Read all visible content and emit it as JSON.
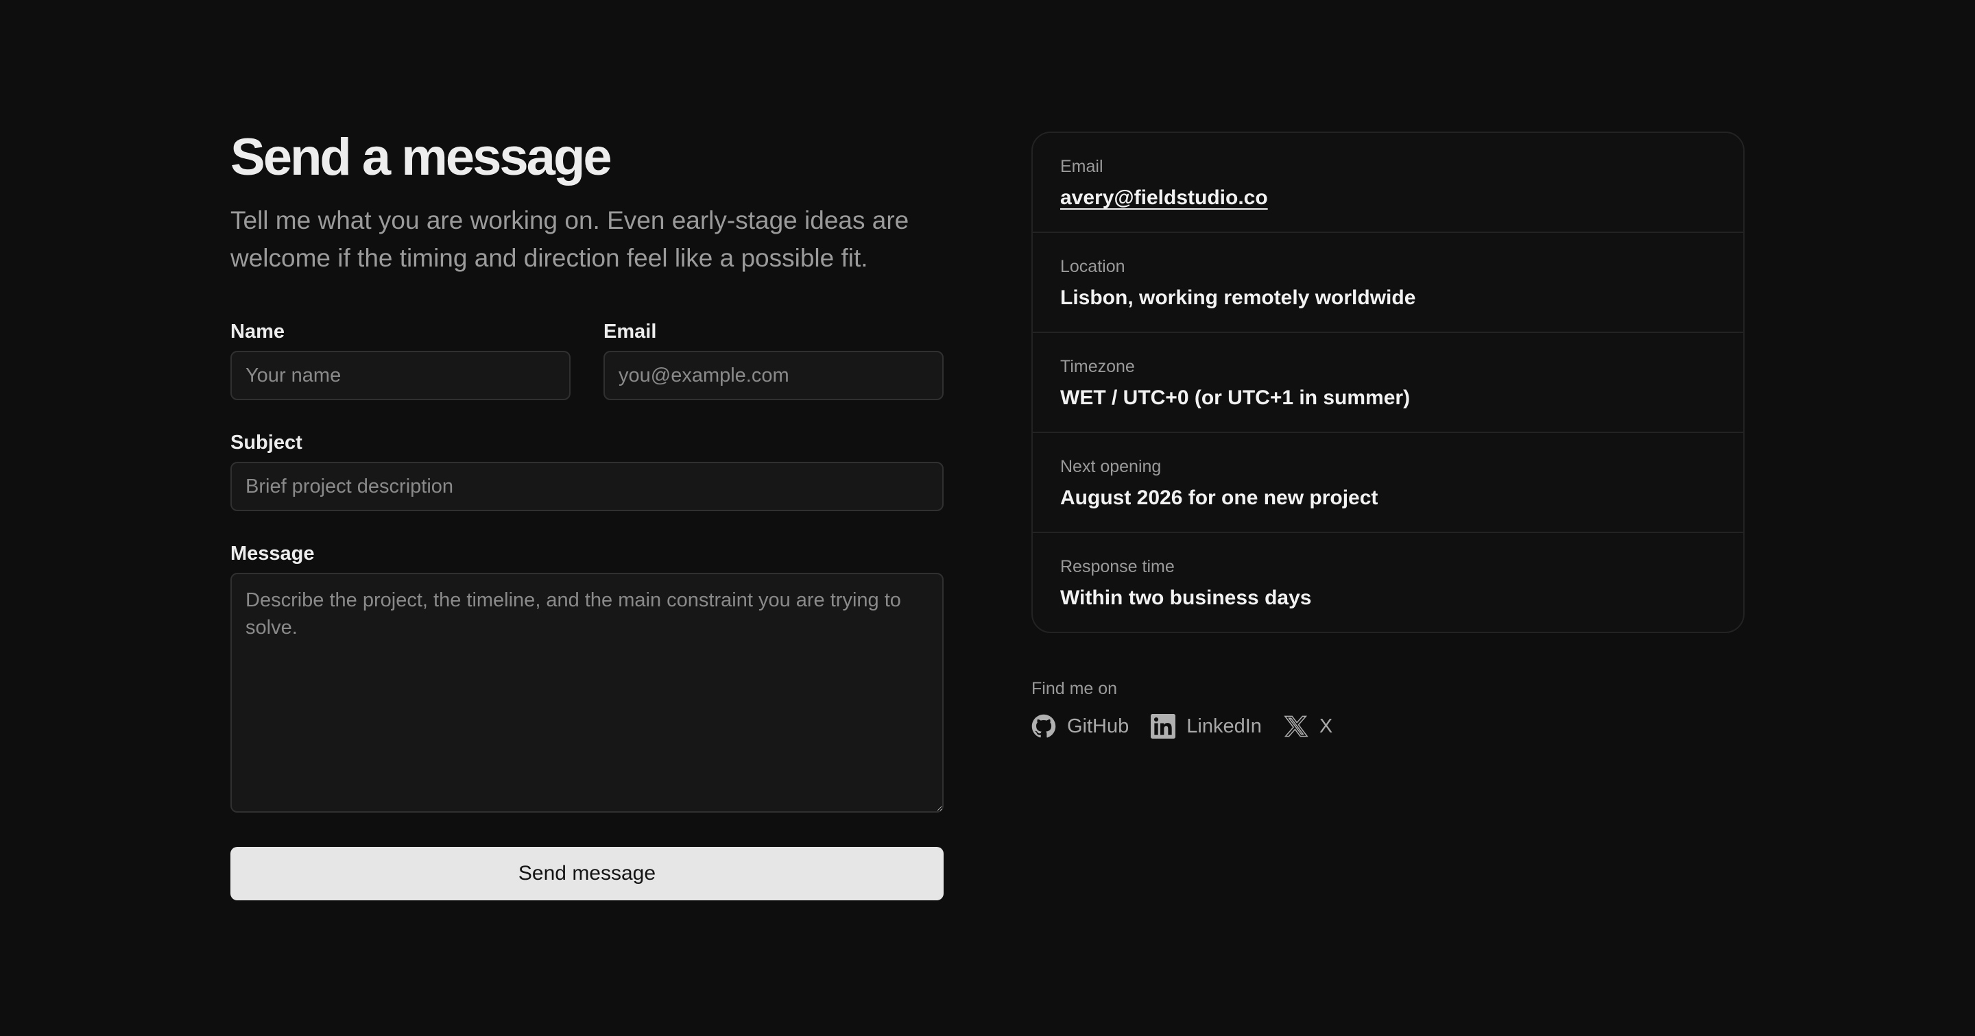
{
  "form": {
    "title": "Send a message",
    "intro": "Tell me what you are working on. Even early-stage ideas are welcome if the timing and direction feel like a possible fit.",
    "name": {
      "label": "Name",
      "placeholder": "Your name"
    },
    "email": {
      "label": "Email",
      "placeholder": "you@example.com"
    },
    "subject": {
      "label": "Subject",
      "placeholder": "Brief project description"
    },
    "message": {
      "label": "Message",
      "placeholder": "Describe the project, the timeline, and the main constraint you are trying to solve."
    },
    "submit_label": "Send message"
  },
  "info": {
    "email": {
      "label": "Email",
      "value": "avery@fieldstudio.co"
    },
    "location": {
      "label": "Location",
      "value": "Lisbon, working remotely worldwide"
    },
    "timezone": {
      "label": "Timezone",
      "value": "WET / UTC+0 (or UTC+1 in summer)"
    },
    "next_opening": {
      "label": "Next opening",
      "value": "August 2026 for one new project"
    },
    "response_time": {
      "label": "Response time",
      "value": "Within two business days"
    }
  },
  "social": {
    "title": "Find me on",
    "links": [
      {
        "label": "GitHub",
        "icon": "github-icon"
      },
      {
        "label": "LinkedIn",
        "icon": "linkedin-icon"
      },
      {
        "label": "X",
        "icon": "x-icon"
      }
    ]
  }
}
